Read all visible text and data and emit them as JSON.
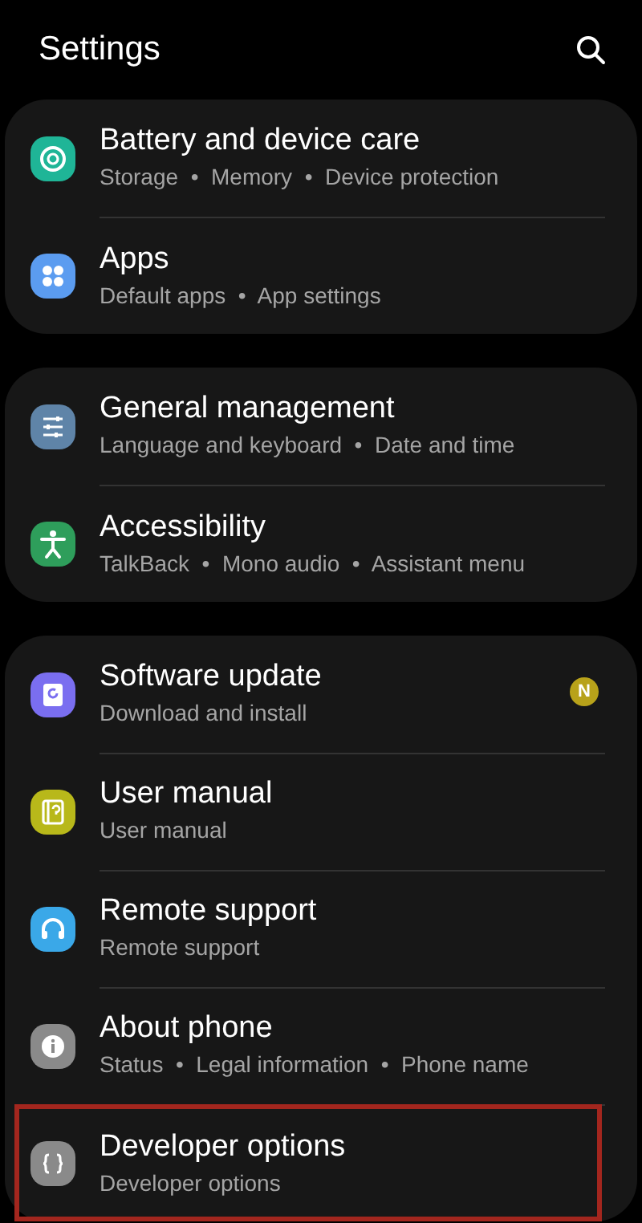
{
  "header": {
    "title": "Settings"
  },
  "groups": [
    {
      "items": [
        {
          "title": "Battery and device care",
          "details": "Storage  •  Memory  •  Device protection",
          "kind": "battery-care",
          "color": "#1fb597",
          "selected": false
        },
        {
          "title": "Apps",
          "details": "Default apps  •  App settings",
          "kind": "apps",
          "color": "#5b9cf0",
          "selected": false
        }
      ]
    },
    {
      "items": [
        {
          "title": "General management",
          "details": "Language and keyboard  •  Date and time",
          "kind": "sliders",
          "color": "#5f84a8",
          "selected": false
        },
        {
          "title": "Accessibility",
          "details": "TalkBack  •  Mono audio  •  Assistant menu",
          "kind": "person",
          "color": "#2e9e5b",
          "selected": false
        }
      ]
    },
    {
      "items": [
        {
          "title": "Software update",
          "details": "Download and install",
          "kind": "update",
          "color": "#7a6ef0",
          "selected": false,
          "badge": "N"
        },
        {
          "title": "User manual",
          "details": "User manual",
          "kind": "manual",
          "color": "#b8b81a",
          "selected": false
        },
        {
          "title": "Remote support",
          "details": "Remote support",
          "kind": "headset",
          "color": "#3aa8e8",
          "selected": false
        },
        {
          "title": "About phone",
          "details": "Status  •  Legal information  •  Phone name",
          "kind": "info",
          "color": "#8a8a8a",
          "selected": false
        },
        {
          "title": "Developer options",
          "details": "Developer options",
          "kind": "braces",
          "color": "#8a8a8a",
          "selected": true
        }
      ]
    }
  ]
}
